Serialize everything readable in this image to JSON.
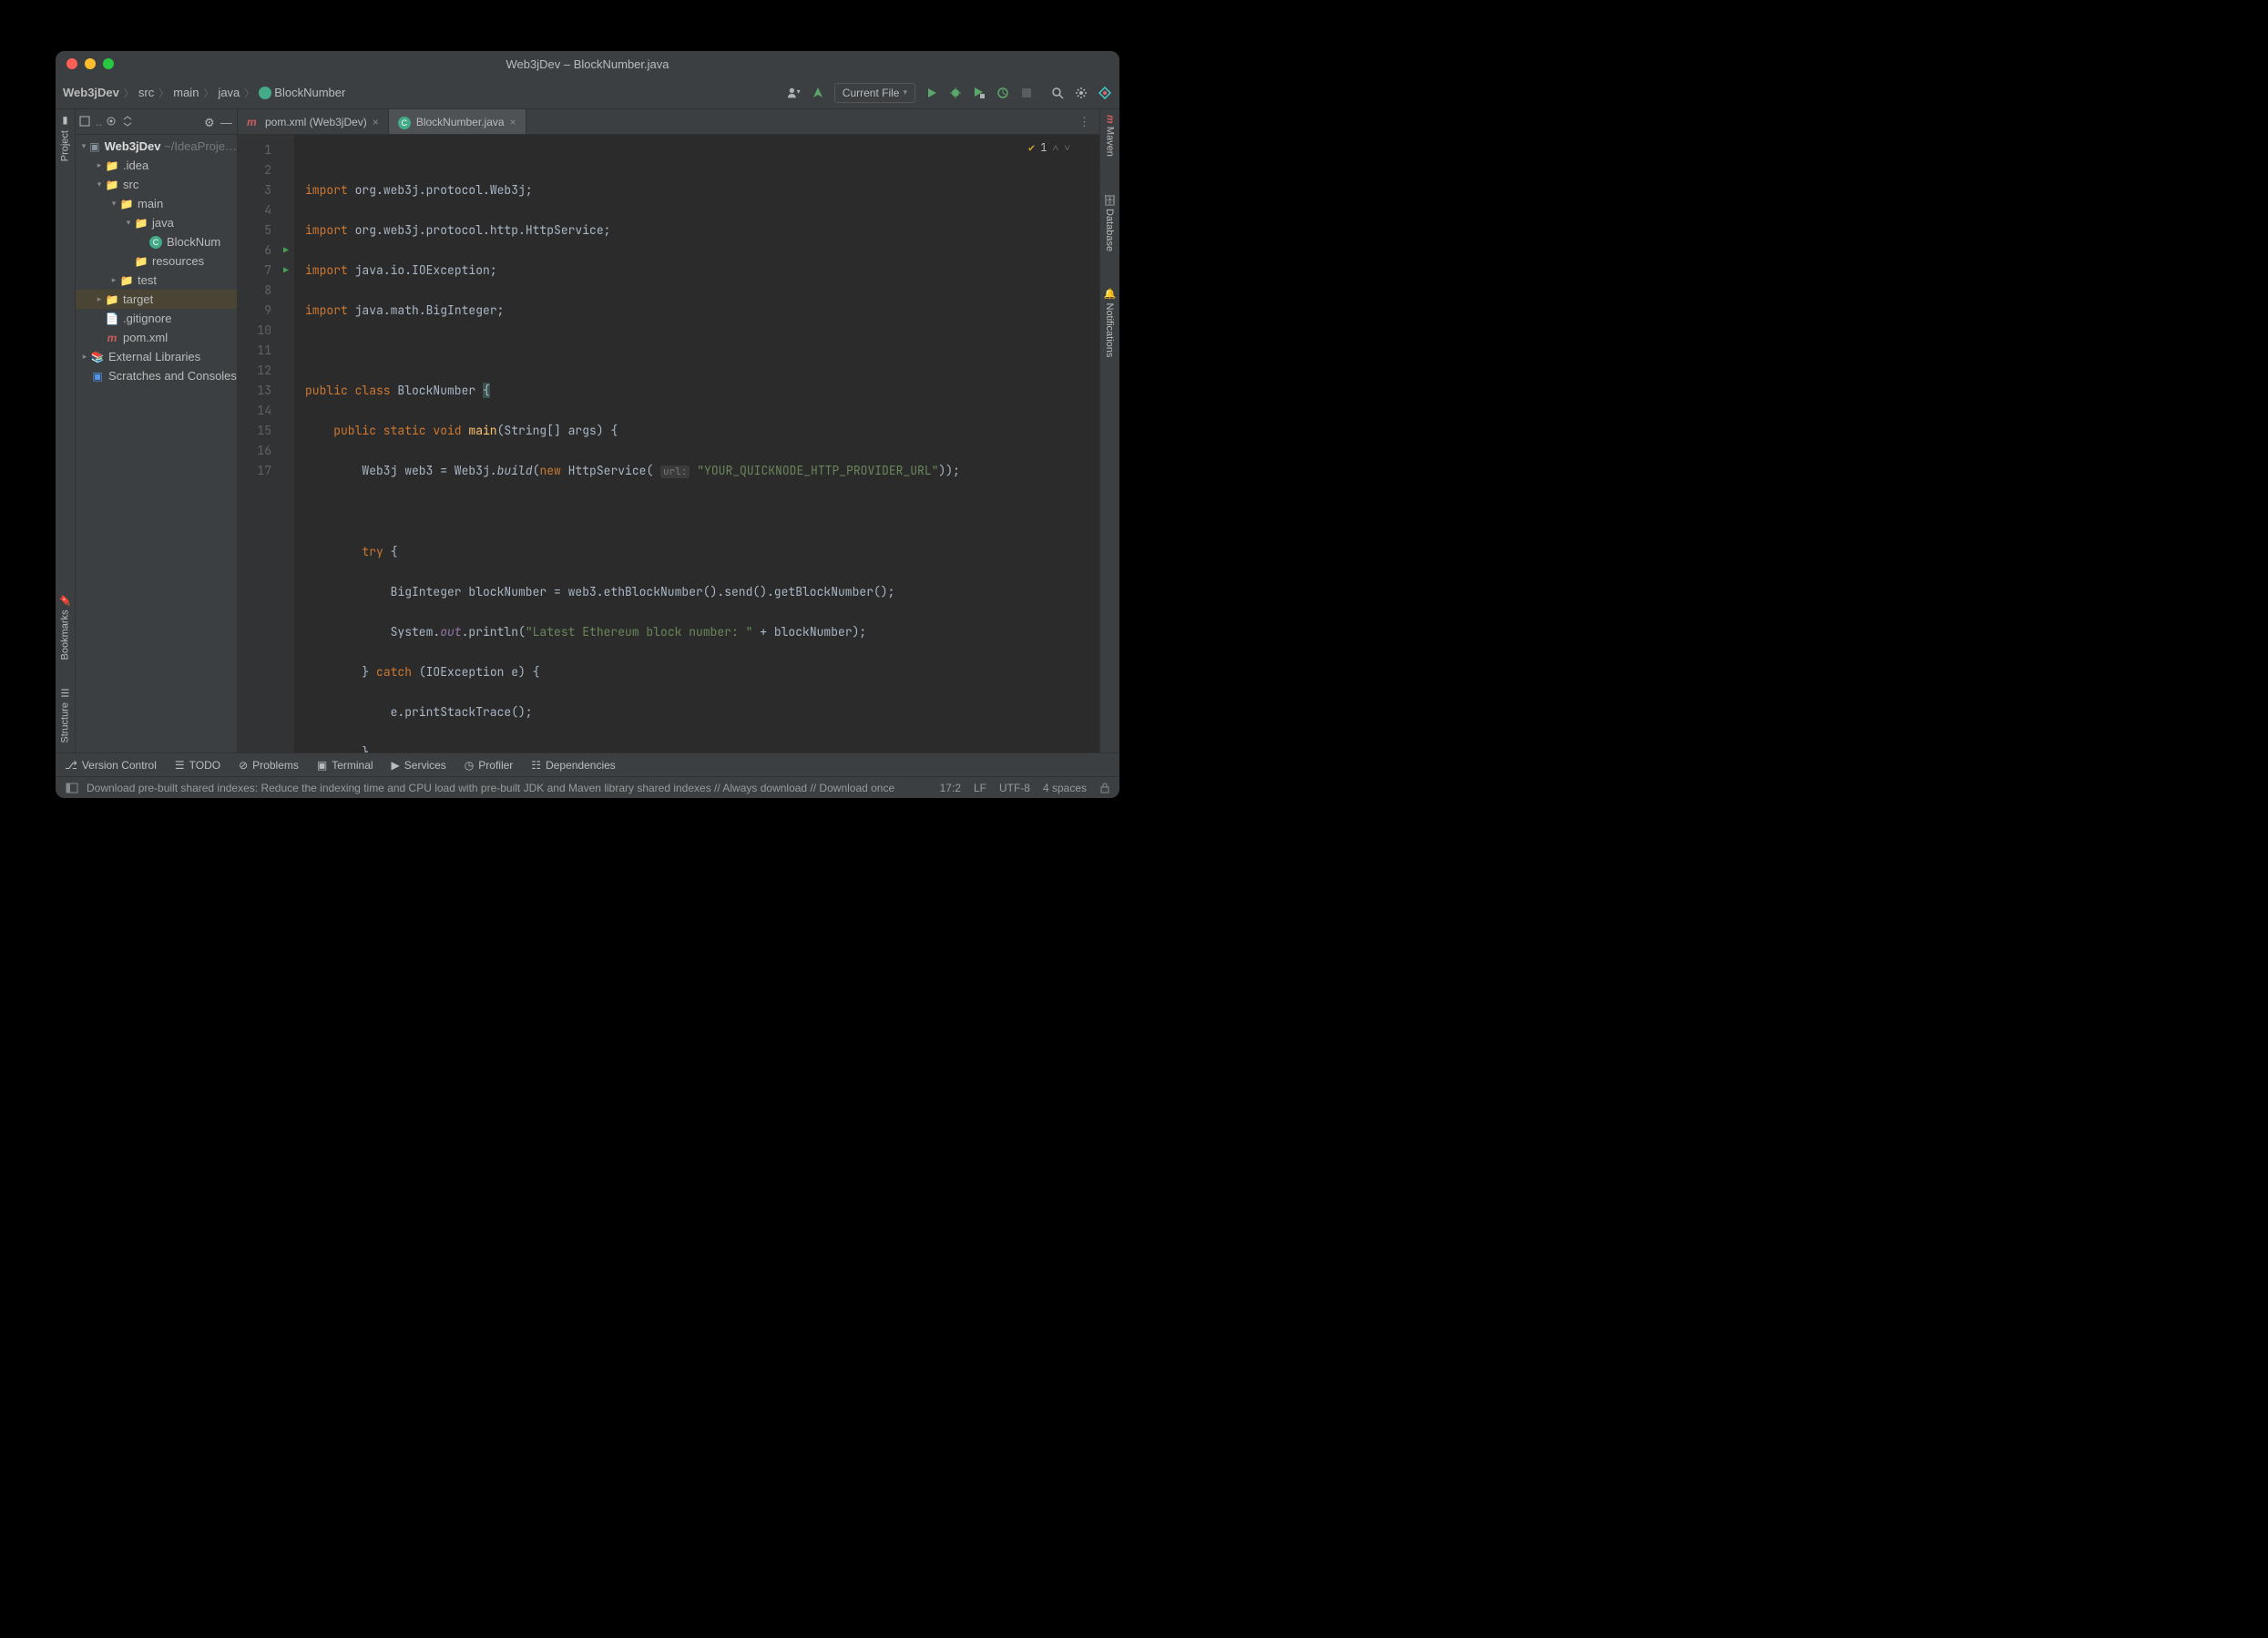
{
  "window": {
    "title": "Web3jDev – BlockNumber.java"
  },
  "breadcrumb": {
    "items": [
      "Web3jDev",
      "src",
      "main",
      "java",
      "BlockNumber"
    ]
  },
  "toolbar": {
    "run_config": "Current File"
  },
  "project_tree": {
    "root": "Web3jDev",
    "root_path": "~/IdeaProje…",
    "idea": ".idea",
    "src": "src",
    "main": "main",
    "java": "java",
    "blocknum": "BlockNum",
    "resources": "resources",
    "test": "test",
    "target": "target",
    "gitignore": ".gitignore",
    "pom": "pom.xml",
    "ext": "External Libraries",
    "scratch": "Scratches and Consoles"
  },
  "tabs": {
    "t1": "pom.xml (Web3jDev)",
    "t2": "BlockNumber.java"
  },
  "inspection": {
    "count": "1"
  },
  "code": {
    "l1a": "import",
    "l1b": " org.web3j.protocol.Web3j;",
    "l2a": "import",
    "l2b": " org.web3j.protocol.http.HttpService;",
    "l3a": "import",
    "l3b": " java.io.IOException;",
    "l4a": "import",
    "l4b": " java.math.BigInteger;",
    "l6a": "public class ",
    "l6b": "BlockNumber ",
    "l6c": "{",
    "l7a": "    public static void ",
    "l7b": "main",
    "l7c": "(String[] args) {",
    "l8a": "        Web3j web3 = Web3j.",
    "l8b": "build",
    "l8c": "(",
    "l8d": "new ",
    "l8e": "HttpService( ",
    "l8hint": "url:",
    "l8f": " \"YOUR_QUICKNODE_HTTP_PROVIDER_URL\"",
    "l8g": "));",
    "l10a": "        try ",
    "l10b": "{",
    "l11a": "            BigInteger blockNumber = web3.ethBlockNumber().send().getBlockNumber();",
    "l12a": "            System.",
    "l12b": "out",
    "l12c": ".println(",
    "l12d": "\"Latest Ethereum block number: \"",
    "l12e": " + blockNumber);",
    "l13a": "        } ",
    "l13b": "catch ",
    "l13c": "(IOException e) {",
    "l14a": "            e.printStackTrace();",
    "l15a": "        }",
    "l16a": "    }",
    "l17a": "}"
  },
  "line_numbers": [
    "1",
    "2",
    "3",
    "4",
    "5",
    "6",
    "7",
    "8",
    "9",
    "10",
    "11",
    "12",
    "13",
    "14",
    "15",
    "16",
    "17"
  ],
  "bottom_tools": {
    "vcs": "Version Control",
    "todo": "TODO",
    "problems": "Problems",
    "terminal": "Terminal",
    "services": "Services",
    "profiler": "Profiler",
    "deps": "Dependencies"
  },
  "status": {
    "msg": "Download pre-built shared indexes: Reduce the indexing time and CPU load with pre-built JDK and Maven library shared indexes // Always download // Download once",
    "pos": "17:2",
    "lf": "LF",
    "enc": "UTF-8",
    "indent": "4 spaces"
  },
  "side_left": {
    "project": "Project",
    "bookmarks": "Bookmarks",
    "structure": "Structure"
  },
  "side_right": {
    "maven": "Maven",
    "database": "Database",
    "notif": "Notifications"
  }
}
